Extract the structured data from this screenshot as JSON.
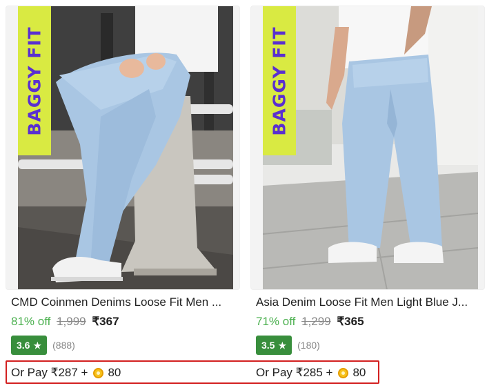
{
  "products": [
    {
      "badge": "BAGGY FIT",
      "title": "CMD Coinmen Denims Loose Fit Men ...",
      "discount": "81% off",
      "mrp": "1,999",
      "price": "₹367",
      "rating": "3.6",
      "rating_count": "(888)",
      "pay_text": "Or Pay ₹287 +",
      "coins": "80"
    },
    {
      "badge": "BAGGY FIT",
      "title": "Asia Denim Loose Fit Men Light Blue J...",
      "discount": "71% off",
      "mrp": "1,299",
      "price": "₹365",
      "rating": "3.5",
      "rating_count": "(180)",
      "pay_text": "Or Pay ₹285 +",
      "coins": "80"
    }
  ],
  "colors": {
    "ribbon": "#d9ea42",
    "ribbon_text": "#5a2fd0",
    "discount": "#4bb04f",
    "rating_badge": "#388e3c",
    "highlight_border": "#d32020",
    "denim": "#a9c6e3"
  },
  "icons": {
    "rating": "star-icon",
    "coin": "supercoin-icon"
  }
}
